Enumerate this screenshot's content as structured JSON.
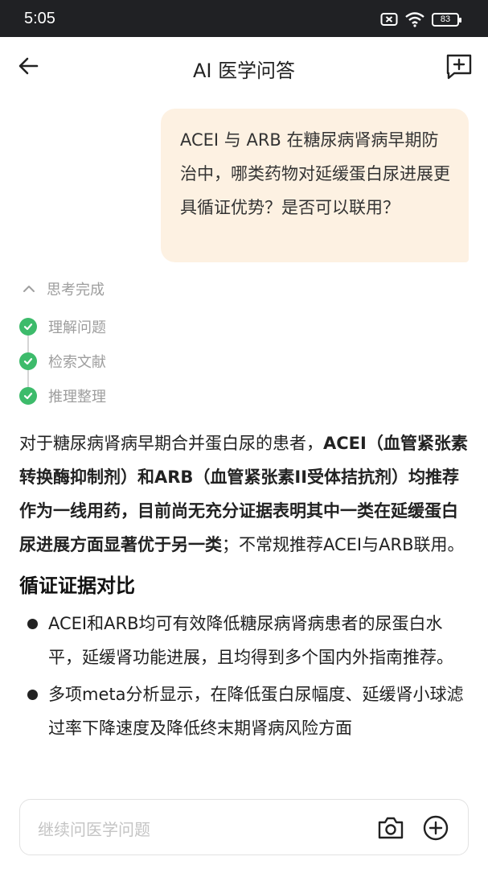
{
  "status_bar": {
    "time": "5:05",
    "battery": "83"
  },
  "header": {
    "title": "AI 医学问答"
  },
  "user_message": "ACEI 与 ARB 在糖尿病肾病早期防治中，哪类药物对延缓蛋白尿进展更具循证优势？是否可以联用？",
  "thinking": {
    "status": "思考完成",
    "steps": [
      "理解问题",
      "检索文献",
      "推理整理"
    ]
  },
  "answer": {
    "intro_plain1": "对于糖尿病肾病早期合并蛋白尿的患者，",
    "intro_bold": "ACEI（血管紧张素转换酶抑制剂）和ARB（血管紧张素II受体拮抗剂）均推荐作为一线用药，目前尚无充分证据表明其中一类在延缓蛋白尿进展方面显著优于另一类",
    "intro_plain2": "；不常规推荐ACEI与ARB联用。",
    "section_title": "循证证据对比",
    "bullets": [
      "ACEI和ARB均可有效降低糖尿病肾病患者的尿蛋白水平，延缓肾功能进展，且均得到多个国内外指南推荐。",
      "多项meta分析显示，在降低蛋白尿幅度、延缓肾小球滤过率下降速度及降低终末期肾病风险方面"
    ]
  },
  "input": {
    "placeholder": "继续问医学问题"
  }
}
